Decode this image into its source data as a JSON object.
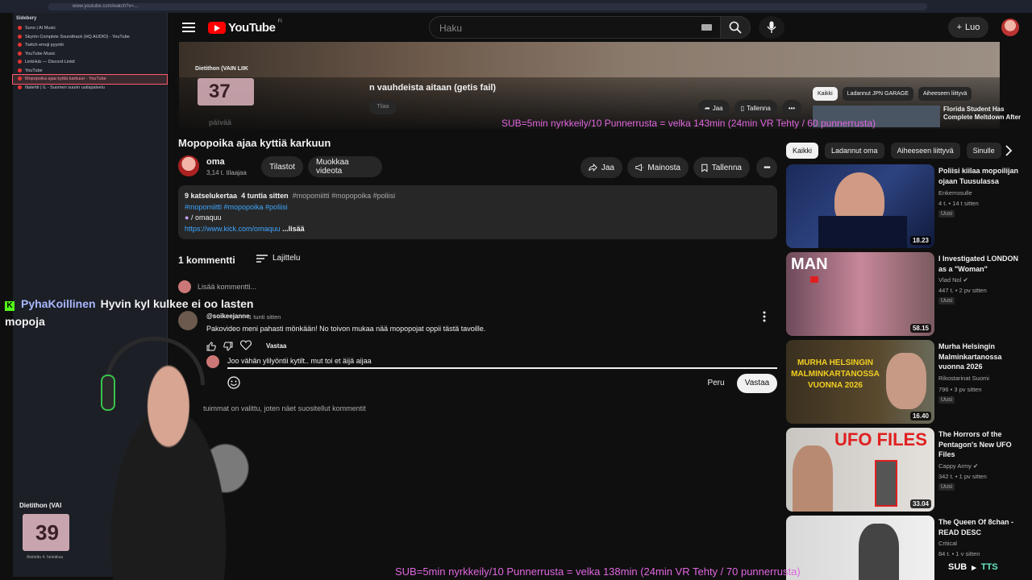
{
  "browser": {
    "url": "www.youtube.com/watch?v=..."
  },
  "sidebery": {
    "title": "Sidebery",
    "items": [
      {
        "label": "Suno | AI Music",
        "active": false
      },
      {
        "label": "Skyrim Complete Soundtrack (HQ AUDIO) - YouTube",
        "active": false
      },
      {
        "label": "Twitch emoji pyyntö",
        "active": false
      },
      {
        "label": "YouTube Music",
        "active": false
      },
      {
        "label": "LinkHub — Discord Linkit",
        "active": false
      },
      {
        "label": "YouTube",
        "active": false
      },
      {
        "label": "Mopopoika ajaa kyttiä karkuun - YouTube",
        "active": true
      },
      {
        "label": "Iltalehti | IL - Suomen suurin uutispalvelu",
        "active": false
      }
    ]
  },
  "header": {
    "logo": "YouTube",
    "country_code": "FI",
    "search_placeholder": "Haku",
    "create_label": "Luo"
  },
  "miniplayer": {
    "title_fragment": "n vauhdeista aitaan (getis fail)",
    "subscribe_label": "Tilaa",
    "share_label": "Jaa",
    "save_label": "Tallenna",
    "chips": [
      "Kaikki",
      "Ladannut JPN GARAGE",
      "Aiheeseen liittyvä"
    ],
    "rec_title": "Florida Student Has Complete Meltdown After",
    "dieth_label": "Dietithon (VAIN LIIK",
    "days_number": "37",
    "days_unit": "päivää"
  },
  "stream_overlay": {
    "subs_ticker_top": "SUB=5min nyrkkeily/10 Punnerrusta = velka 143min (24min VR Tehty / 60 punnerrusta)",
    "subs_ticker_bottom": "SUB=5min nyrkkeily/10 Punnerrusta = velka 138min (24min VR Tehty / 70 punnerrusta)",
    "chat_user": "PyhaKoillinen",
    "chat_message": "Hyvin kyl kulkee ei oo lasten mopoja",
    "dieth_label": "Dietithon (VAI",
    "days_number": "39",
    "days_footer": "Aloitettu 4. heinäkuu",
    "sub_label": "SUB",
    "tts_label": "TTS"
  },
  "video": {
    "title": "Mopopoika ajaa kyttiä karkuun",
    "channel": "oma",
    "subscribers": "3,14 t. tilaajaa",
    "stats_label": "Tilastot",
    "edit_label": "Muokkaa videota",
    "share_label": "Jaa",
    "promote_label": "Mainosta",
    "save_label": "Tallenna"
  },
  "description": {
    "views": "9 katselukertaa",
    "age": "4 tuntia sitten",
    "tags_gray": "#mopomiitti #mopopoika #poliisi",
    "tags_blue": "#mopomiitti #mopopoika #poliisi",
    "channel_handle": "/ omaquu",
    "link": "https://www.kick.com/omaquu",
    "more": "...lisää"
  },
  "comments": {
    "count_label": "1 kommentti",
    "sort_label": "Lajittelu",
    "add_placeholder": "Lisää kommentti...",
    "items": [
      {
        "author": "@soikeejanne",
        "time": "1 tunti sitten",
        "text": "Pakovideo meni pahasti mönkään! No toivon mukaa nää mopopojat oppii tästä tavoille.",
        "reply_label": "Vastaa"
      }
    ],
    "reply_draft": "Joo vähän ylilyöntii kytilt.. mut toi et äijä aijaa",
    "cancel_label": "Peru",
    "submit_label": "Vastaa",
    "sort_note": "tuimmat on valittu, joten näet suositellut kommentit"
  },
  "related": {
    "chips": [
      "Kaikki",
      "Ladannut oma",
      "Aiheeseen liittyvä",
      "Sinulle"
    ],
    "videos": [
      {
        "title": "Poliisi kiilaa mopoilijan ojaan Tuusulassa",
        "channel": "Enkerrosulle",
        "verified": false,
        "views": "4 t.",
        "age": "14 t sitten",
        "badge": "Uusi",
        "duration": "18.23"
      },
      {
        "title": "I Investigated LONDON as a \"Woman\"",
        "channel": "Vlad Nol",
        "verified": true,
        "views": "447 t.",
        "age": "2 pv sitten",
        "badge": "Uusi",
        "duration": "58.15"
      },
      {
        "title": "Murha Helsingin Malminkartanossa vuonna 2026",
        "channel": "Rikostarinat Suomi",
        "verified": false,
        "views": "796",
        "age": "3 pv sitten",
        "badge": "Uusi",
        "duration": "16.40"
      },
      {
        "title": "The Horrors of the Pentagon's New UFO Files",
        "channel": "Cappy Army",
        "verified": true,
        "views": "342 t.",
        "age": "1 pv sitten",
        "badge": "Uusi",
        "duration": "33.04"
      },
      {
        "title": "The Queen Of 8chan - READ DESC",
        "channel": "Critical",
        "verified": false,
        "views": "84 t.",
        "age": "1 v sitten",
        "badge": "",
        "duration": ""
      }
    ],
    "thumb_text": {
      "man": "MAN",
      "murha": "MURHA HELSINGIN MALMINKARTANOSSA VUONNA 2026",
      "ufo": "UFO FILES"
    }
  },
  "colors": {
    "accent_red": "#ff0000",
    "link_blue": "#3ea6ff",
    "overlay_pink": "#e067e0",
    "kick_green": "#53fc18"
  }
}
